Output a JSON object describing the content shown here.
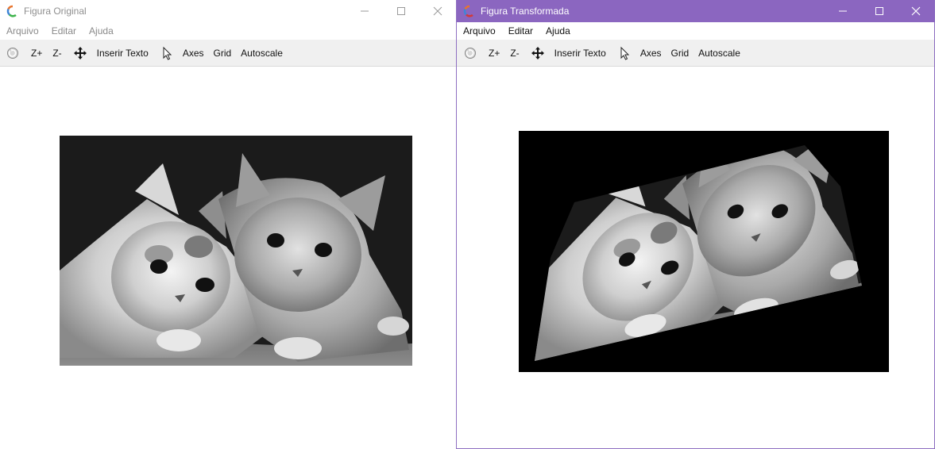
{
  "window_original": {
    "title": "Figura Original",
    "menu": [
      "Arquivo",
      "Editar",
      "Ajuda"
    ],
    "toolbar": {
      "zoom_in": "Z+",
      "zoom_out": "Z-",
      "insert_text": "Inserir Texto",
      "axes": "Axes",
      "grid": "Grid",
      "autoscale": "Autoscale"
    }
  },
  "window_transformed": {
    "title": "Figura Transformada",
    "menu": [
      "Arquivo",
      "Editar",
      "Ajuda"
    ],
    "toolbar": {
      "zoom_in": "Z+",
      "zoom_out": "Z-",
      "insert_text": "Inserir Texto",
      "axes": "Axes",
      "grid": "Grid",
      "autoscale": "Autoscale"
    }
  },
  "colors": {
    "active_title_bar": "#8b66c0",
    "inactive_title_text": "#8f8f8f",
    "toolbar_bg": "#f0f0f0"
  },
  "icons": [
    "app-icon",
    "minimize-icon",
    "maximize-icon",
    "close-icon",
    "rotate-icon",
    "pan-icon",
    "pointer-icon"
  ]
}
